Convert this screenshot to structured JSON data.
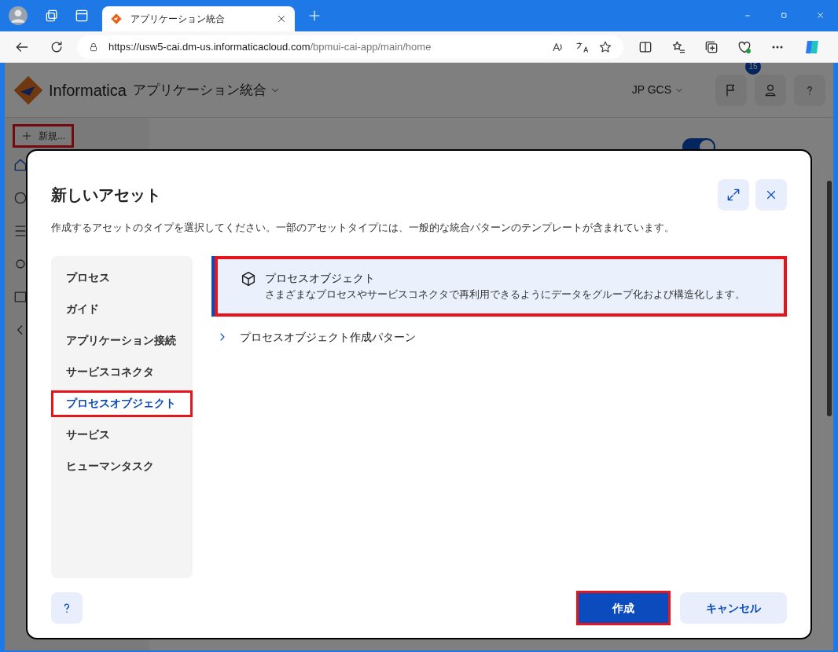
{
  "browser": {
    "tab": {
      "title": "アプリケーション統合",
      "selected": true
    },
    "url_host": "https://usw5-cai.dm-us.informaticacloud.com",
    "url_path": "/bpmui-cai-app/main/home"
  },
  "app_header": {
    "brand": "Informatica",
    "app_name": "アプリケーション統合",
    "org": "JP GCS",
    "notification_count": "15"
  },
  "sidebar": {
    "new_button": "新規..."
  },
  "home": {
    "toggle_on": true
  },
  "modal": {
    "title": "新しいアセット",
    "description": "作成するアセットのタイプを選択してください。一部のアセットタイプには、一般的な統合パターンのテンプレートが含まれています。",
    "categories": [
      {
        "label": "プロセス",
        "selected": false
      },
      {
        "label": "ガイド",
        "selected": false
      },
      {
        "label": "アプリケーション接続",
        "selected": false
      },
      {
        "label": "サービスコネクタ",
        "selected": false
      },
      {
        "label": "プロセスオブジェクト",
        "selected": true
      },
      {
        "label": "サービス",
        "selected": false
      },
      {
        "label": "ヒューマンタスク",
        "selected": false
      }
    ],
    "asset_cards": [
      {
        "title": "プロセスオブジェクト",
        "description": "さまざまなプロセスやサービスコネクタで再利用できるようにデータをグループ化および構造化します。",
        "selected": true
      }
    ],
    "patterns": [
      {
        "label": "プロセスオブジェクト作成パターン",
        "expanded": false
      }
    ],
    "create_button": "作成",
    "cancel_button": "キャンセル"
  }
}
